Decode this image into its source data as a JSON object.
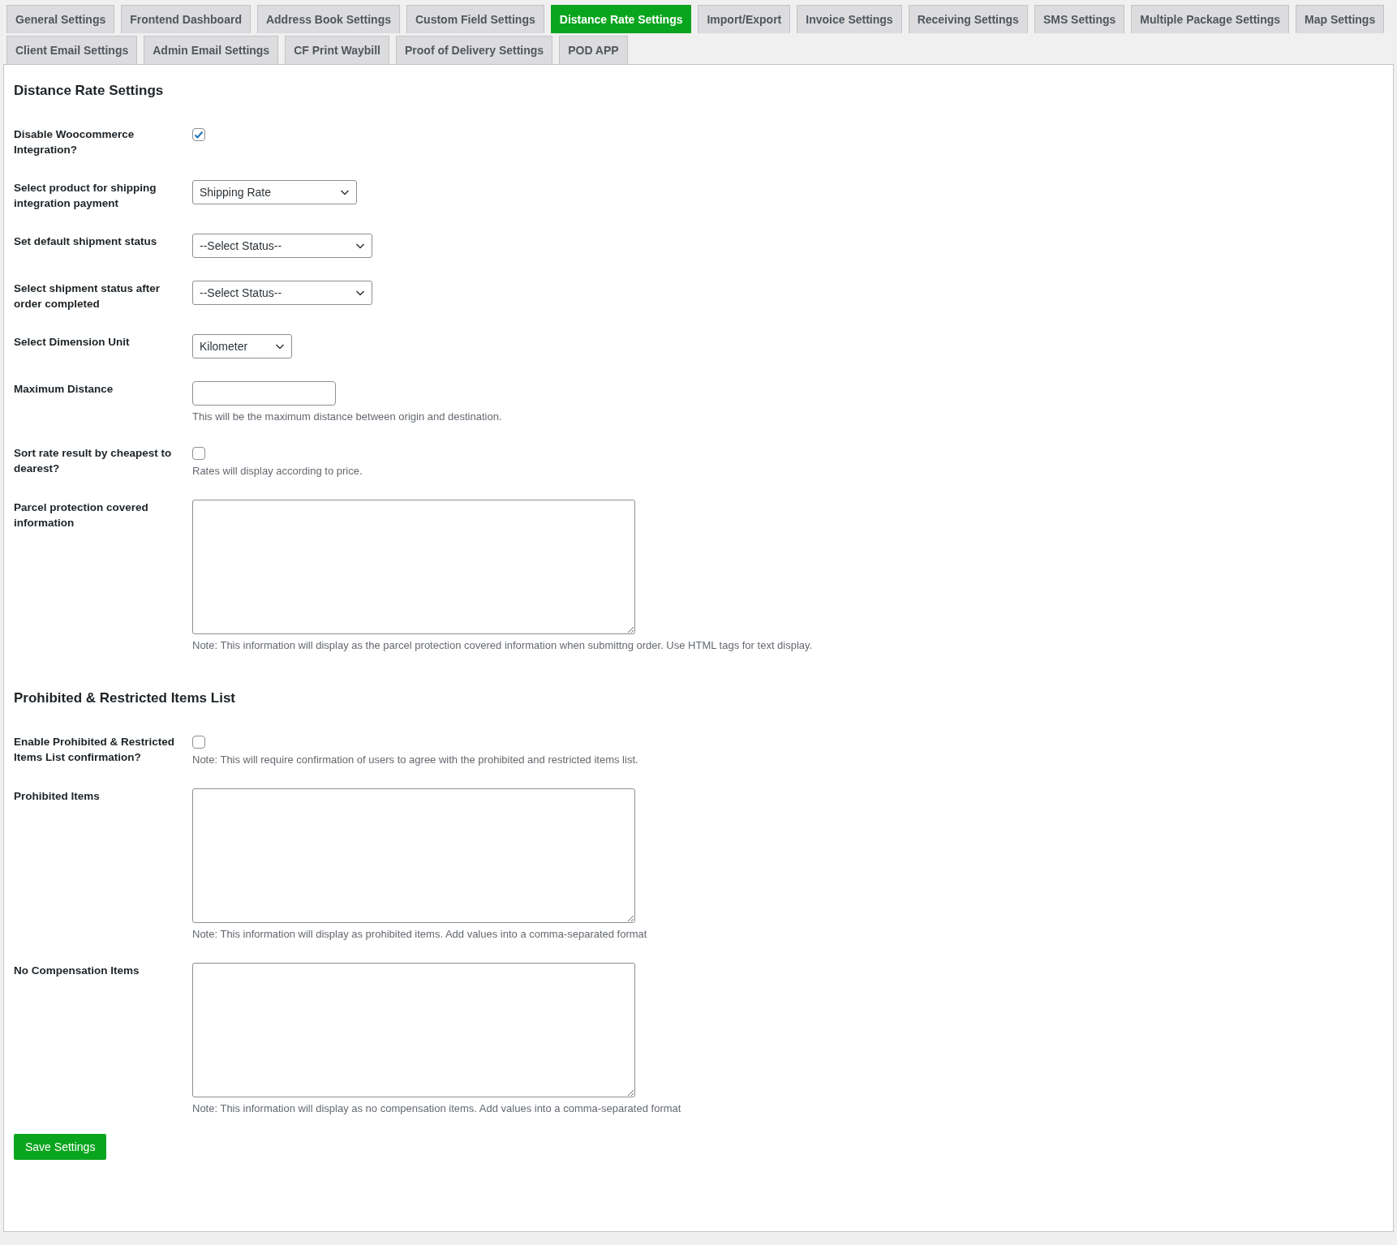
{
  "tabs": [
    {
      "label": "General Settings",
      "selected": false
    },
    {
      "label": "Frontend Dashboard",
      "selected": false
    },
    {
      "label": "Address Book Settings",
      "selected": false
    },
    {
      "label": "Custom Field Settings",
      "selected": false
    },
    {
      "label": "Distance Rate Settings",
      "selected": true
    },
    {
      "label": "Import/Export",
      "selected": false
    },
    {
      "label": "Invoice Settings",
      "selected": false
    },
    {
      "label": "Receiving Settings",
      "selected": false
    },
    {
      "label": "SMS Settings",
      "selected": false
    },
    {
      "label": "Multiple Package Settings",
      "selected": false
    },
    {
      "label": "Map Settings",
      "selected": false
    },
    {
      "label": "Client Email Settings",
      "selected": false
    },
    {
      "label": "Admin Email Settings",
      "selected": false
    },
    {
      "label": "CF Print Waybill",
      "selected": false
    },
    {
      "label": "Proof of Delivery Settings",
      "selected": false
    },
    {
      "label": "POD APP",
      "selected": false
    }
  ],
  "sections": [
    {
      "heading": "Distance Rate Settings",
      "fields": [
        {
          "kind": "checkbox",
          "label": "Disable Woocommerce Integration?",
          "checked": true
        },
        {
          "kind": "select",
          "label": "Select product for shipping integration payment",
          "value": "Shipping Rate"
        },
        {
          "kind": "select",
          "label": "Set default shipment status",
          "value": "--Select Status--"
        },
        {
          "kind": "select",
          "label": "Select shipment status after order completed",
          "value": "--Select Status--"
        },
        {
          "kind": "select",
          "label": "Select Dimension Unit",
          "value": "Kilometer"
        },
        {
          "kind": "text",
          "label": "Maximum Distance",
          "description": "This will be the maximum distance between origin and destination."
        },
        {
          "kind": "checkbox",
          "label": "Sort rate result by cheapest to dearest?",
          "checked": false,
          "description": "Rates will display according to price."
        },
        {
          "kind": "textarea",
          "label": "Parcel protection covered information",
          "description": "Note: This information will display as the parcel protection covered information when submittng order. Use HTML tags for text display."
        }
      ]
    },
    {
      "heading": "Prohibited & Restricted Items List",
      "fields": [
        {
          "kind": "checkbox",
          "label": "Enable Prohibited & Restricted Items List confirmation?",
          "checked": false,
          "description": "Note: This will require confirmation of users to agree with the prohibited and restricted items list."
        },
        {
          "kind": "textarea",
          "label": "Prohibited Items",
          "description": "Note: This information will display as prohibited items. Add values into a comma-separated format"
        },
        {
          "kind": "textarea",
          "label": "No Compensation Items",
          "description": "Note: This information will display as no compensation items. Add values into a comma-separated format"
        }
      ]
    }
  ],
  "save_button": "Save Settings"
}
